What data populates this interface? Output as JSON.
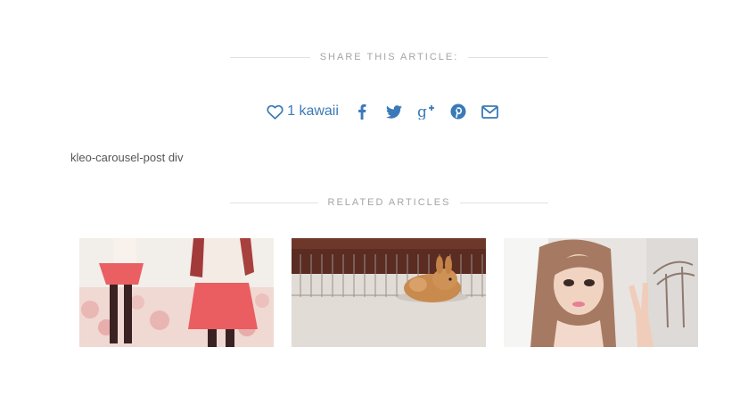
{
  "share": {
    "title": "SHARE THIS ARTICLE:",
    "kawaii_label": "1 kawaii",
    "icons": [
      "heart-icon",
      "facebook-icon",
      "twitter-icon",
      "google-plus-icon",
      "pinterest-icon",
      "email-icon"
    ]
  },
  "debug_text": "kleo-carousel-post div",
  "related": {
    "title": "RELATED ARTICLES",
    "items": [
      {
        "image": "two-girls-in-coral-skirts-photo"
      },
      {
        "image": "bunny-in-cage-photo"
      },
      {
        "image": "girl-peace-sign-selfie-photo"
      }
    ]
  },
  "colors": {
    "accent": "#3a7ab8",
    "heading": "#a5a5a5",
    "rule": "#e2e2e2",
    "text": "#555555"
  }
}
